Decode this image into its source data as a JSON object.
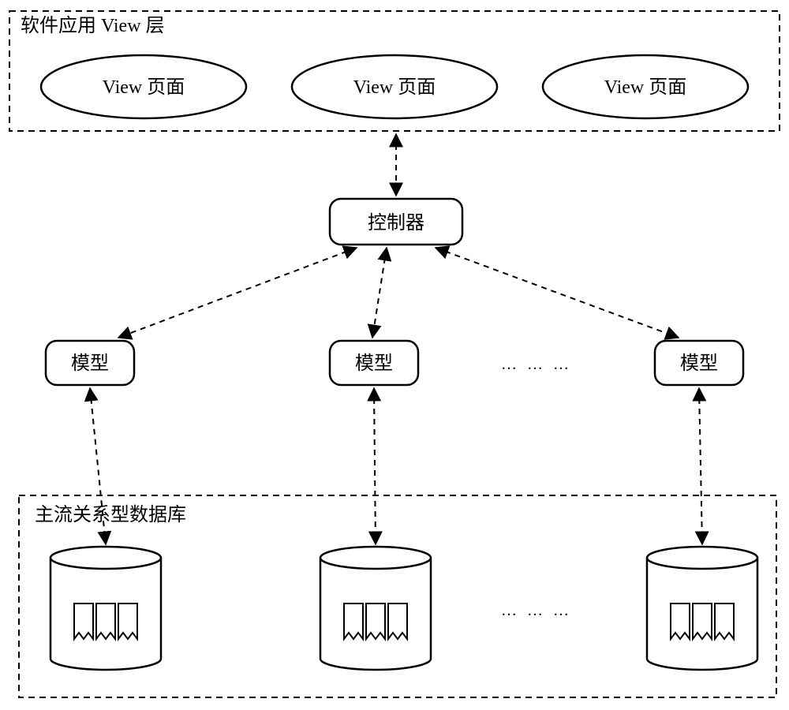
{
  "view_layer": {
    "title": "软件应用 View 层",
    "pages": [
      "View 页面",
      "View 页面",
      "View 页面"
    ]
  },
  "controller": {
    "label": "控制器"
  },
  "models": {
    "labels": [
      "模型",
      "模型",
      "模型"
    ],
    "ellipsis": "… … …"
  },
  "db_layer": {
    "title": "主流关系型数据库",
    "count": 3,
    "ellipsis": "… … …"
  }
}
